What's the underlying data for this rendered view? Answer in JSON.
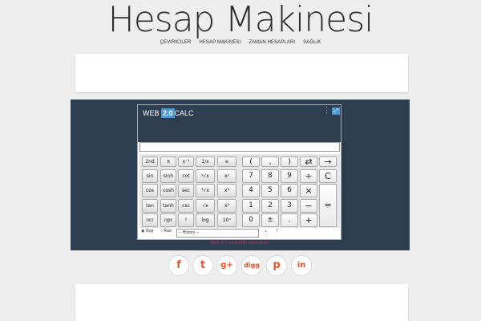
{
  "site": {
    "title": "Hesap Makinesi"
  },
  "nav": {
    "items": [
      "ÇEVIRICILER",
      "HESAP MAKINESI",
      "ZAMAN HESAPLARI",
      "SAĞLIK"
    ]
  },
  "calculator": {
    "logo_left": "WEB",
    "logo_hl": "2.0",
    "logo_right": "CALC",
    "menu_icon": "⋮",
    "expand_icon": "⤢",
    "rows": [
      [
        "2nd",
        "π",
        "x⁻¹",
        "1/x",
        "e",
        "(",
        ",",
        ")",
        "⇄",
        "→"
      ],
      [
        "sin",
        "sinh",
        "cot",
        "ʸ√x",
        "xʸ",
        "7",
        "8",
        "9",
        "÷",
        "C"
      ],
      [
        "cos",
        "cosh",
        "sec",
        "³√x",
        "x³",
        "4",
        "5",
        "6",
        "×"
      ],
      [
        "tan",
        "tanh",
        "csc",
        "√x",
        "x²",
        "1",
        "2",
        "3",
        "−",
        "="
      ],
      [
        "ncr",
        "npr",
        "!",
        "log",
        "10ˣ",
        "0",
        "±",
        ".",
        "+"
      ]
    ],
    "deg_label": "Deg",
    "rad_label": "Rad",
    "history_label": "-- History --",
    "history_btn1": "↓",
    "history_btn2": "↑",
    "caption": "Web 2.0 scientific calculator"
  },
  "social": {
    "icons": [
      "f",
      "t",
      "g+",
      "digg",
      "p",
      "in"
    ],
    "color": "#e8542d"
  }
}
